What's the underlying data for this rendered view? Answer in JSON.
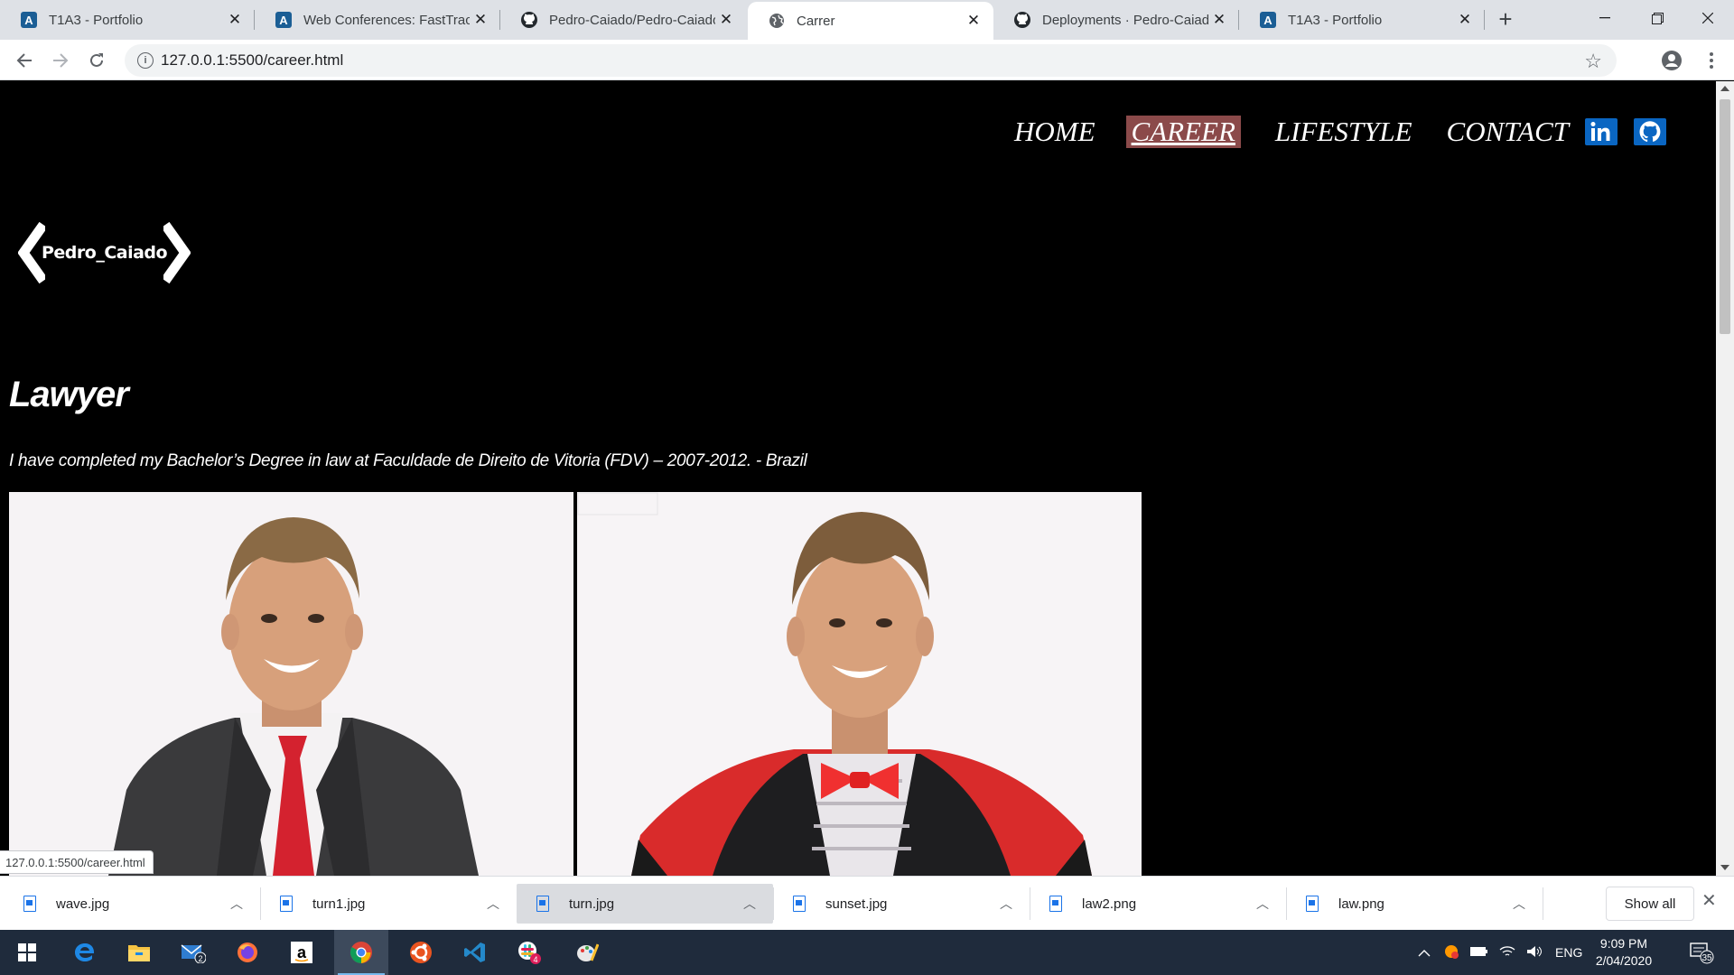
{
  "browser": {
    "tabs": [
      {
        "title": "T1A3 - Portfolio",
        "icon": "atom-favicon"
      },
      {
        "title": "Web Conferences: FastTrack",
        "icon": "atom-favicon"
      },
      {
        "title": "Pedro-Caiado/Pedro-Caiado",
        "icon": "github-favicon"
      },
      {
        "title": "Carrer",
        "icon": "globe-favicon"
      },
      {
        "title": "Deployments · Pedro-Caiado",
        "icon": "github-favicon"
      },
      {
        "title": "T1A3 - Portfolio",
        "icon": "atom-favicon"
      }
    ],
    "active_tab": 3,
    "url": "127.0.0.1:5500/career.html",
    "status_url": "127.0.0.1:5500/career.html"
  },
  "site": {
    "nav": {
      "home": "HOME",
      "career": "CAREER",
      "lifestyle": "LIFESTYLE",
      "contact": "CONTACT"
    },
    "logo_text": "Pedro_Caiado",
    "heading": "Lawyer",
    "description": "I have completed my Bachelor’s Degree in law at Faculdade de Direito de Vitoria (FDV) – 2007-2012. - Brazil",
    "active_nav_color": "#8b4a4a"
  },
  "downloads": {
    "files": [
      "wave.jpg",
      "turn1.jpg",
      "turn.jpg",
      "sunset.jpg",
      "law2.png",
      "law.png"
    ],
    "selected": 2,
    "show_all": "Show all"
  },
  "taskbar": {
    "mail_badge": "2",
    "slack_badge": "4",
    "language": "ENG",
    "time": "9:09 PM",
    "date": "2/04/2020",
    "notifications": "35"
  }
}
